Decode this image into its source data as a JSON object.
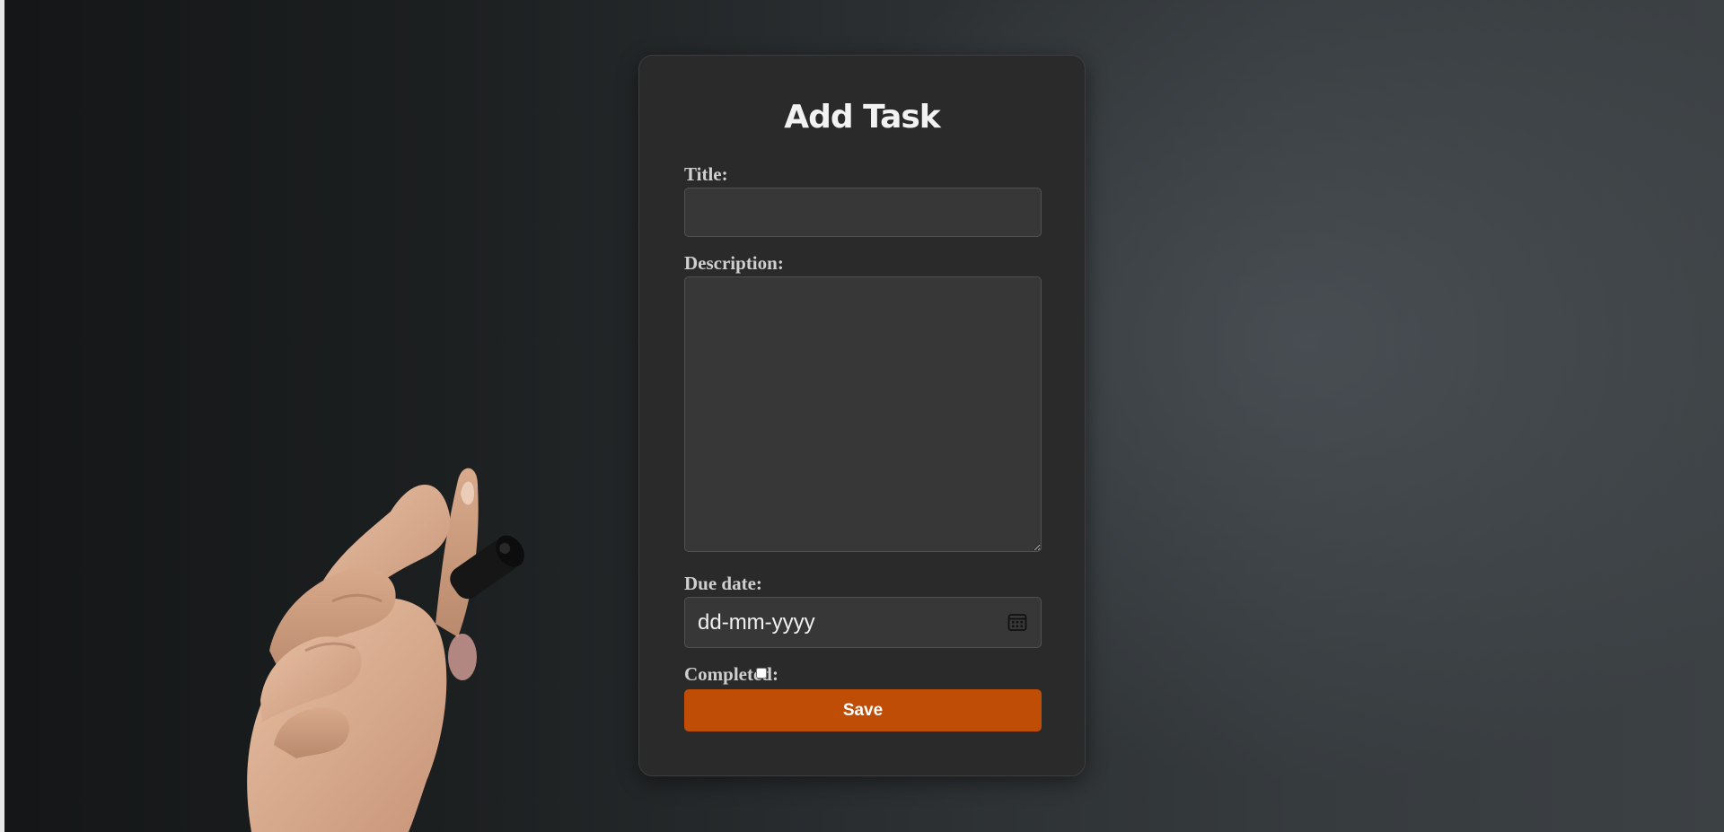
{
  "form": {
    "title": "Add Task",
    "title_label": "Title:",
    "title_value": "",
    "description_label": "Description:",
    "description_value": "",
    "due_date_label": "Due date:",
    "due_date_placeholder": "dd-mm-yyyy",
    "completed_label": "Completed:",
    "completed_checked": false,
    "save_label": "Save"
  },
  "icons": {
    "date_picker": "calendar-icon"
  },
  "colors": {
    "accent": "#bf4d06",
    "card_background": "#2a2a2a",
    "input_background": "#373737"
  }
}
